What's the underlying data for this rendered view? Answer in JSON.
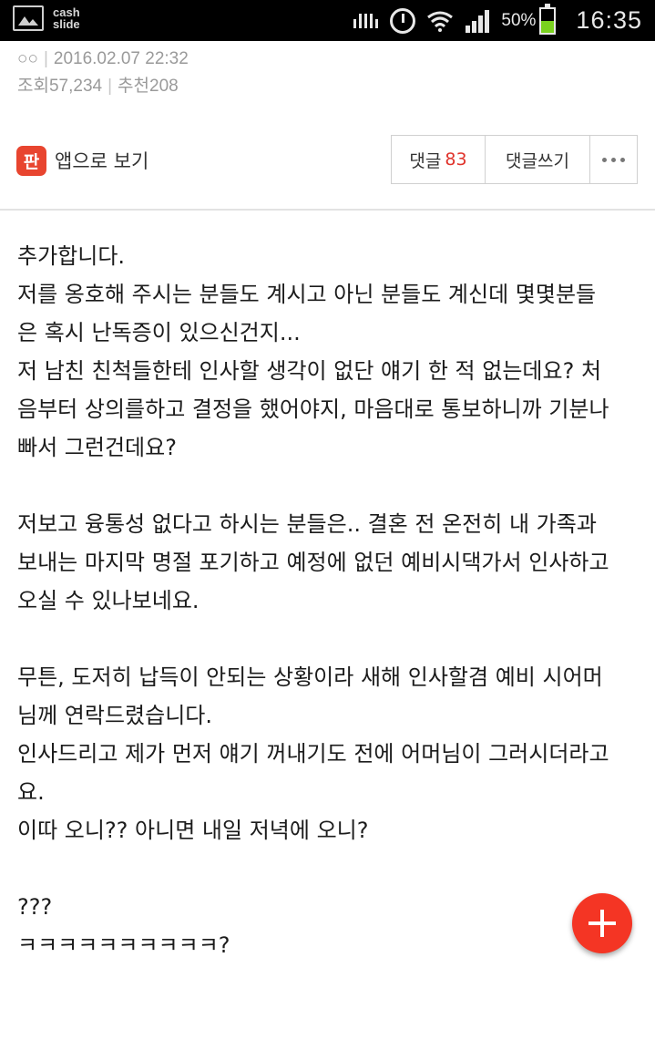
{
  "status_bar": {
    "app_label_line1": "cash",
    "app_label_line2": "slide",
    "battery_percent": "50%",
    "battery_level": 0.5,
    "time": "16:35",
    "icons": [
      "gallery-icon",
      "mute-icon",
      "alarm-icon",
      "wifi-icon",
      "signal-icon",
      "battery-icon"
    ]
  },
  "post_meta": {
    "author": "○○",
    "datetime": "2016.02.07 22:32",
    "views_label": "조회",
    "views": "57,234",
    "recommend_label": "추천",
    "recommend": "208"
  },
  "action_bar": {
    "app_logo_text": "판",
    "app_view_label": "앱으로 보기",
    "comment_label": "댓글",
    "comment_count": "83",
    "write_comment_label": "댓글쓰기",
    "more_icon": "more-dots-icon"
  },
  "post_body": {
    "lines": [
      "추가합니다.",
      "저를 옹호해 주시는 분들도 계시고 아닌 분들도 계신데 몇몇분들",
      "은 혹시 난독증이 있으신건지...",
      "저 남친 친척들한테 인사할 생각이 없단 얘기 한 적 없는데요? 처",
      "음부터 상의를하고 결정을 했어야지, 마음대로 통보하니까 기분나",
      "빠서 그런건데요?",
      "",
      "저보고 융통성 없다고 하시는 분들은.. 결혼 전 온전히 내 가족과",
      "보내는 마지막 명절 포기하고 예정에 없던 예비시댁가서 인사하고",
      "오실 수 있나보네요.",
      "",
      "무튼, 도저히 납득이 안되는 상황이라 새해 인사할겸 예비 시어머",
      "님께 연락드렸습니다.",
      "인사드리고 제가 먼저 얘기 꺼내기도 전에 어머님이 그러시더라고",
      "요.",
      "이따 오니?? 아니면 내일 저녁에 오니?",
      "",
      "???",
      "ㅋㅋㅋㅋㅋㅋㅋㅋㅋㅋ?"
    ]
  },
  "fab": {
    "icon": "plus-icon"
  },
  "colors": {
    "status_bar_bg": "#000000",
    "accent_red": "#e0332b",
    "fab_red": "#f43524",
    "battery_green": "#7ad21f",
    "meta_gray": "#9a9a9a"
  }
}
